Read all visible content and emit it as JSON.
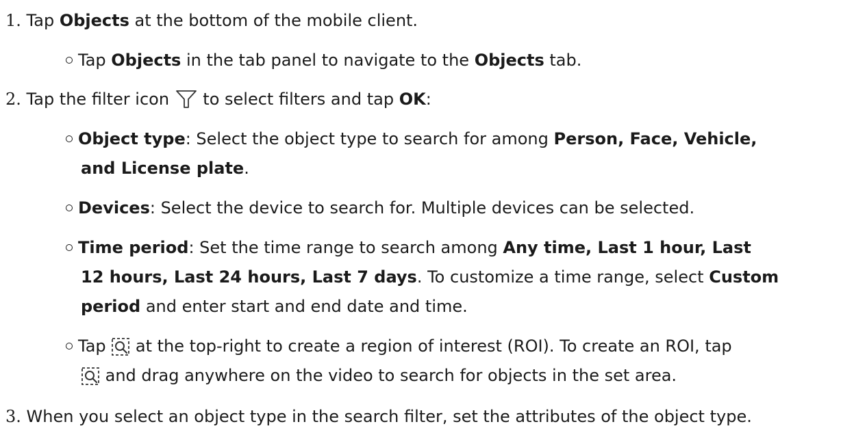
{
  "steps": [
    {
      "number": "1.",
      "text_a": "Tap ",
      "bold_a": "Objects",
      "text_b": " at the bottom of the mobile client."
    },
    {
      "number": "2.",
      "text_a": "Tap the filter icon ",
      "text_b": " to select filters and tap ",
      "bold_a": "OK",
      "text_c": ":"
    },
    {
      "number": "3.",
      "text_a": "When you select an object type in the search filter, set the attributes of the object type."
    }
  ],
  "sub1": {
    "text_a": "Tap ",
    "bold_a": "Objects",
    "text_b": " in the tab panel to navigate to the ",
    "bold_b": "Objects",
    "text_c": " tab."
  },
  "object_type": {
    "label": "Object type",
    "text_a": ": Select the object type to search for among ",
    "bold_a": "Person, Face, Vehicle,",
    "bold_b": "and License plate",
    "text_b": "."
  },
  "devices": {
    "label": "Devices",
    "text_a": ": Select the device to search for. Multiple devices can be selected."
  },
  "time_period": {
    "label": "Time period",
    "text_a": ": Set the time range to search among ",
    "bold_a": "Any time, Last 1 hour, Last",
    "bold_b": "12 hours, Last 24 hours, Last 7 days",
    "text_b": ". To customize a time range, select ",
    "bold_c": "Custom",
    "bold_d": "period",
    "text_c": " and enter start and end date and time."
  },
  "roi": {
    "text_a": "Tap ",
    "text_b": " at the top-right to create a region of interest (ROI). To create an ROI, tap",
    "text_c": " and drag anywhere on the video to search for objects in the set area."
  },
  "icons": {
    "filter": "filter-icon",
    "roi": "roi-search-icon"
  }
}
